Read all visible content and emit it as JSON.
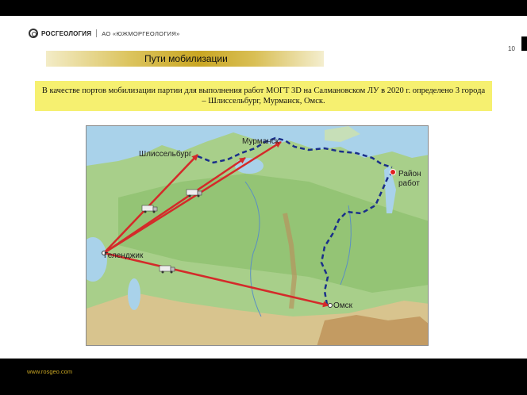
{
  "header": {
    "logo_name": "РОСГЕОЛОГИЯ",
    "logo_subsidiary": "АО «ЮЖМОРГЕОЛОГИЯ»",
    "page_number": "10"
  },
  "slide": {
    "title": "Пути мобилизации",
    "description": "В качестве портов мобилизации партии для выполнения работ МОГТ 3D на Салмановском  ЛУ в 2020 г. определено 3 города – Шлиссельбург, Мурманск, Омск."
  },
  "map": {
    "labels": {
      "origin": "Геленджик",
      "shlisselburg": "Шлиссельбург",
      "murmansk": "Мурманск",
      "omsk": "Омск",
      "work_area_line1": "Район",
      "work_area_line2": "работ"
    },
    "colors": {
      "route_arrow": "#d42a2a",
      "sea_route": "#1a2f8a",
      "work_area_marker": "#e02020",
      "sea": "#a9d2ea",
      "land": "#a8cf8a"
    }
  },
  "footer": {
    "url": "www.rosgeo.com"
  }
}
